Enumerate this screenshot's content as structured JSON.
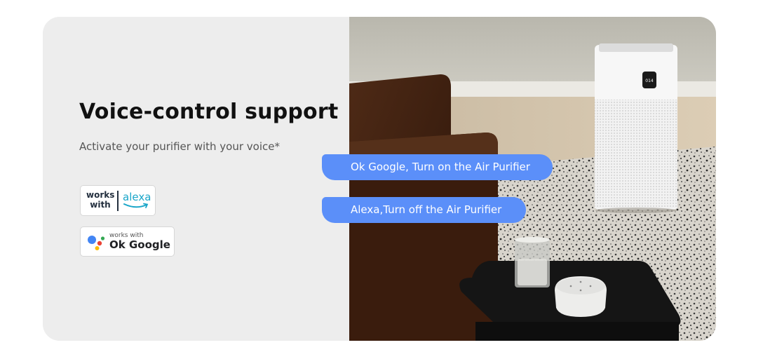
{
  "section": {
    "title": "Voice-control support",
    "subtitle": "Activate your purifier with your voice*"
  },
  "badges": {
    "alexa": {
      "works_line1": "works",
      "works_line2": "with",
      "brand": "alexa",
      "icon": "amazon-smile-icon"
    },
    "google": {
      "works_with": "works with",
      "brand": "Ok Google",
      "icon": "google-assistant-dots-icon"
    }
  },
  "bubbles": [
    {
      "text": "Ok Google, Turn on the Air Purifier"
    },
    {
      "text": "Alexa,Turn off the Air Purifier"
    }
  ],
  "photo": {
    "description_icon": "air-purifier-room-photo",
    "purifier_display": "014"
  },
  "colors": {
    "card_background": "#ededed",
    "bubble": "#5b8ff9",
    "alexa_blue": "#1aa6c9",
    "google_blue": "#4285f4",
    "google_red": "#ea4335",
    "google_yellow": "#fbbc05",
    "google_green": "#34a853"
  }
}
